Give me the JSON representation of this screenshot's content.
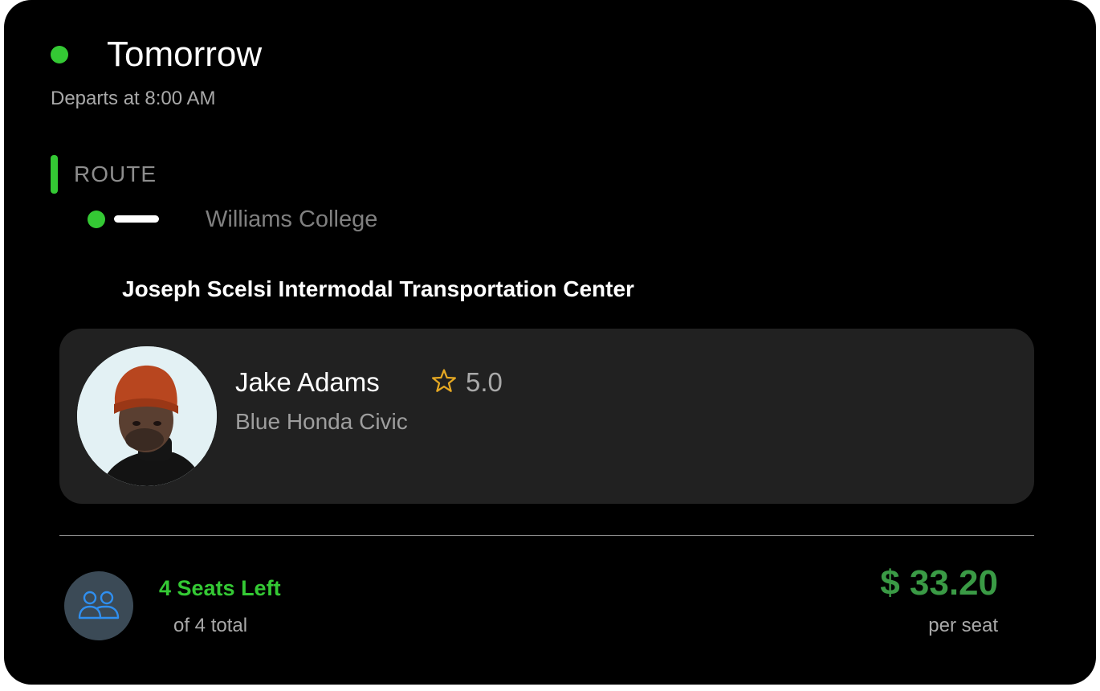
{
  "trip": {
    "day": "Tomorrow",
    "departs": "Departs at 8:00 AM",
    "status_color": "#34c934"
  },
  "route": {
    "label": "ROUTE",
    "origin": "Williams College",
    "destination": "Joseph Scelsi Intermodal Transportation Center"
  },
  "driver": {
    "name": "Jake Adams",
    "rating": "5.0",
    "car": "Blue Honda Civic",
    "rating_icon": "star-outline-icon"
  },
  "seats": {
    "left_label": "4 Seats Left",
    "total_label": "of 4 total",
    "icon": "users-icon"
  },
  "price": {
    "amount": "$ 33.20",
    "unit": "per seat",
    "color": "#3a9a45"
  }
}
